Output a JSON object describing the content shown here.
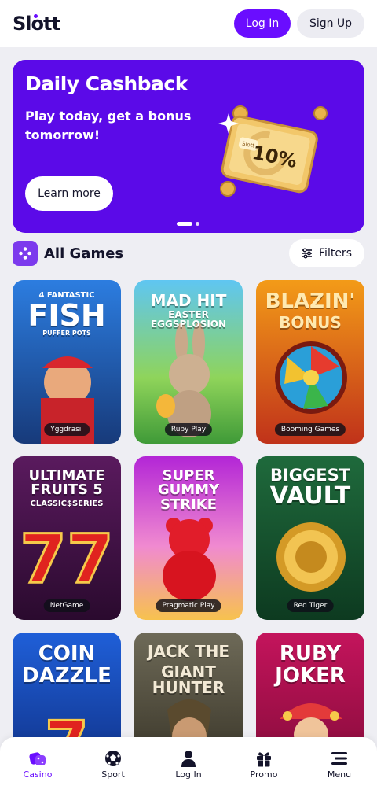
{
  "header": {
    "logo": "Slott",
    "login_label": "Log In",
    "signup_label": "Sign Up"
  },
  "banner": {
    "title": "Daily Cashback",
    "subtitle": "Play today, get a bonus tomorrow!",
    "cta_label": "Learn more",
    "voucher_brand": "Slott",
    "voucher_value": "10%",
    "active_slide": 1,
    "slide_count": 2
  },
  "games_section": {
    "title": "All Games",
    "filters_label": "Filters"
  },
  "games": [
    {
      "pre": "4 FANTASTIC",
      "title": "FISH",
      "sub": "PUFFER POTS",
      "provider": "Yggdrasil"
    },
    {
      "title": "MAD HIT",
      "sub": "EASTER EGGSPLOSION",
      "provider": "Ruby Play"
    },
    {
      "title": "BLAZIN'",
      "sub": "BONUS",
      "provider": "Booming Games"
    },
    {
      "title": "ULTIMATE FRUITS 5",
      "sub": "CLASSIC$SERIES",
      "provider": "NetGame"
    },
    {
      "title": "SUPER GUMMY STRIKE",
      "provider": "Pragmatic Play"
    },
    {
      "title": "BIGGEST",
      "sub": "VAULT",
      "provider": "Red Tiger"
    },
    {
      "title": "COIN",
      "sub": "DAZZLE"
    },
    {
      "title": "JACK THE",
      "sub": "GIANT HUNTER"
    },
    {
      "title": "RUBY",
      "sub": "JOKER"
    }
  ],
  "nav": [
    {
      "label": "Casino",
      "icon": "dice-icon",
      "active": true
    },
    {
      "label": "Sport",
      "icon": "soccer-ball-icon"
    },
    {
      "label": "Log In",
      "icon": "user-icon"
    },
    {
      "label": "Promo",
      "icon": "gift-icon"
    },
    {
      "label": "Menu",
      "icon": "menu-icon"
    }
  ],
  "colors": {
    "accent": "#6a0dff",
    "banner_bg": "#5b0ae8",
    "page_bg": "#eeeef3"
  }
}
